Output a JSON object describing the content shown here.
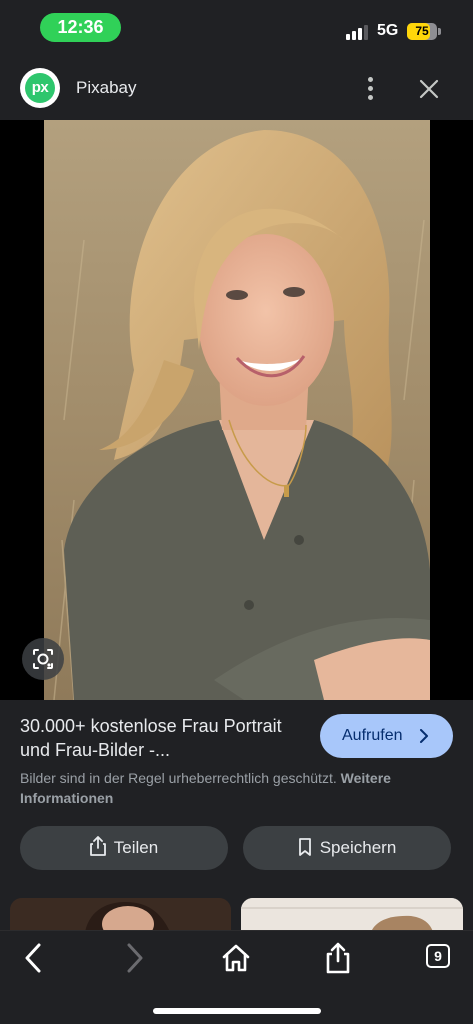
{
  "status_bar": {
    "time": "12:36",
    "network": "5G",
    "battery_level": "75",
    "battery_fraction": 0.75,
    "signal_bars_active": 3,
    "signal_bars_total": 4
  },
  "header": {
    "logo_text": "px",
    "site_name": "Pixabay",
    "more_icon": "more-vert-icon",
    "close_icon": "close-icon"
  },
  "image": {
    "description_icon": "lens-icon"
  },
  "result": {
    "title": "30.000+ kostenlose Frau Portrait und Frau-Bilder -...",
    "visit_label": "Aufrufen",
    "copyright_text": "Bilder sind in der Regel urheberrechtlich geschützt.",
    "copyright_link": "Weitere Informationen"
  },
  "actions": {
    "share_label": "Teilen",
    "save_label": "Speichern"
  },
  "toolbar": {
    "tab_count": "9"
  },
  "colors": {
    "background": "#202124",
    "accent": "#a8c7fa",
    "time_pill": "#30d158",
    "battery": "#ffd60a",
    "logo": "#2ec66d"
  }
}
